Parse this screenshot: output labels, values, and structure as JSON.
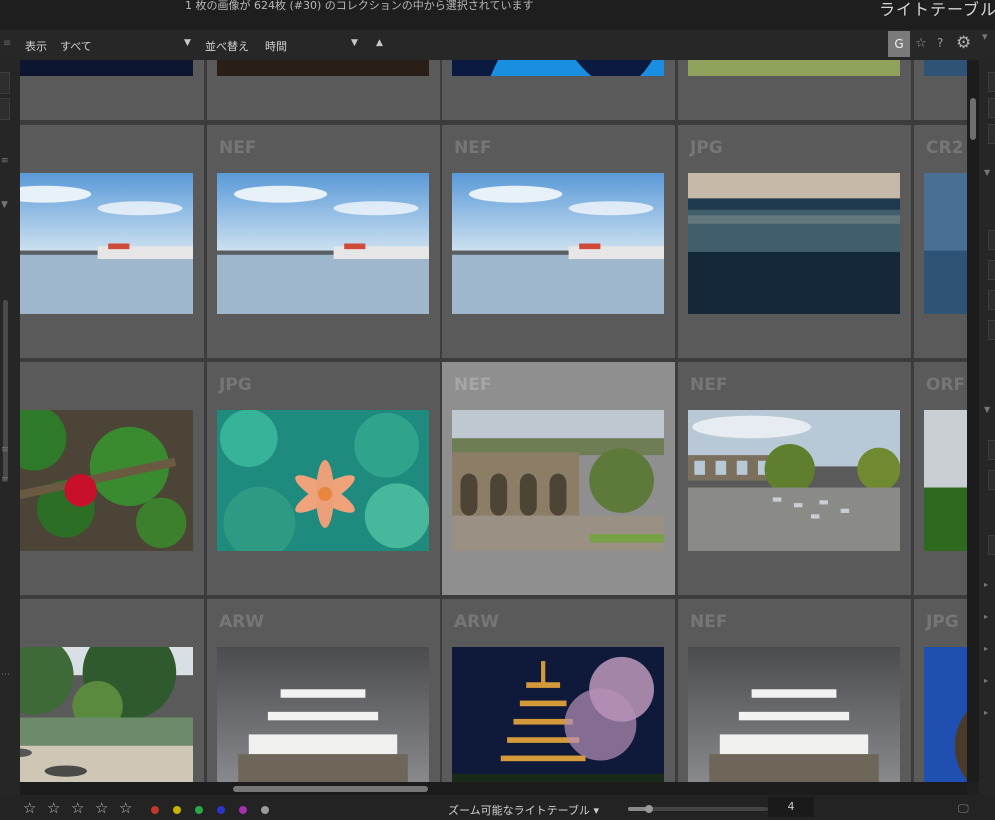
{
  "status": {
    "selection_text": "1 枚の画像が 624枚 (#30) のコレクションの中から選択されています",
    "module_title": "ライトテーブル"
  },
  "filter": {
    "show_label": "表示",
    "show_value": "すべて",
    "sort_label": "並べ替え",
    "sort_value": "時間",
    "sort_direction": "▲",
    "caret": "▼"
  },
  "toolbar": {
    "grouping_button": "G",
    "star_icon": "☆",
    "help_icon": "?",
    "gear_icon": "⚙"
  },
  "grid": {
    "rows": [
      {
        "cells": [
          {
            "format": "",
            "scene": "dark-blue"
          },
          {
            "format": "",
            "scene": "dark-brown"
          },
          {
            "format": "",
            "scene": "blue-splash"
          },
          {
            "format": "",
            "scene": "green-sky"
          },
          {
            "format": "",
            "scene": "sea-partial"
          }
        ]
      },
      {
        "cells": [
          {
            "format": "",
            "scene": "harbor"
          },
          {
            "format": "NEF",
            "scene": "harbor"
          },
          {
            "format": "NEF",
            "scene": "harbor"
          },
          {
            "format": "JPG",
            "scene": "city-fuji"
          },
          {
            "format": "CR2",
            "scene": "sea-partial"
          }
        ]
      },
      {
        "cells": [
          {
            "format": "",
            "scene": "strawberry"
          },
          {
            "format": "JPG",
            "scene": "lily"
          },
          {
            "format": "NEF",
            "scene": "aqueduct-plaza",
            "selected": true
          },
          {
            "format": "NEF",
            "scene": "aqueduct-parking"
          },
          {
            "format": "ORF",
            "scene": "field"
          }
        ]
      },
      {
        "cells": [
          {
            "format": "",
            "scene": "garden"
          },
          {
            "format": "ARW",
            "scene": "castle"
          },
          {
            "format": "ARW",
            "scene": "pagoda"
          },
          {
            "format": "NEF",
            "scene": "castle"
          },
          {
            "format": "JPG",
            "scene": "blue-tree"
          }
        ]
      }
    ]
  },
  "bottom": {
    "stars": [
      "☆",
      "☆",
      "☆",
      "☆",
      "☆"
    ],
    "color_labels": [
      "#c0392b",
      "#c8b400",
      "#27a844",
      "#2a34c8",
      "#a630b0",
      "#9a9a9a"
    ],
    "zoom_mode": "ズーム可能なライトテーブル ▾",
    "zoom_value": "4",
    "zoom_level": 0.15
  }
}
